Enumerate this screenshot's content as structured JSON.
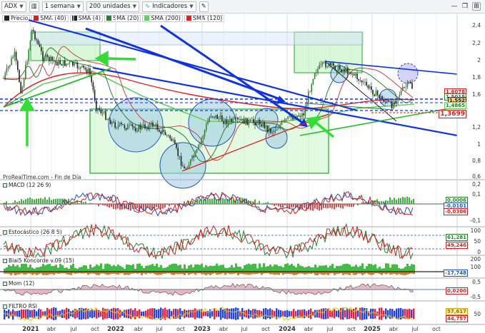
{
  "toolbar": {
    "symbol": "ADX",
    "interval": "1 semana",
    "units": "200 unidades",
    "indicators_label": "Indicadores"
  },
  "legend": [
    {
      "label": "Precio",
      "color": "#222222"
    },
    {
      "label": "SMA (40)",
      "color": "#cc2222"
    },
    {
      "label": "SMA (4)",
      "color": "#222222"
    },
    {
      "label": "SMA (20)",
      "color": "#2e7d32"
    },
    {
      "label": "SMA (200)",
      "color": "#66cc66"
    },
    {
      "label": "SMA (120)",
      "color": "#dd2222"
    }
  ],
  "main_chart": {
    "source_text": "ProRealTime.com - Fin de Día",
    "y_ticks": [
      "2,4",
      "2,2",
      "2",
      "1,8",
      "1,6",
      "1,4",
      "1,2",
      "1",
      "0,8",
      "0,6"
    ],
    "value_boxes": [
      {
        "text": "1,6078",
        "color": "#cc2222"
      },
      {
        "text": "1,5015",
        "color": "#2e7d32"
      },
      {
        "text": "1,552",
        "color": "#222222"
      },
      {
        "text": "1,4865",
        "color": "#66cc66"
      },
      {
        "text": "1,3699",
        "color": "#cc2222"
      }
    ]
  },
  "panels": [
    {
      "name": "MACD (12 26 9)",
      "ticks": [
        "0,2",
        "0,1",
        "0",
        "-0,1"
      ],
      "values": [
        "0,0006",
        "-0,0101",
        "-0,0306"
      ]
    },
    {
      "name": "Estocástico (26 8 5)",
      "ticks": [
        "100",
        "50",
        "0"
      ],
      "values": [
        "61,281",
        "49,246"
      ]
    },
    {
      "name": "Blai5 Koncorde v.09 (15)",
      "ticks": [
        "200",
        "100",
        "0"
      ],
      "values": [
        "-17,748"
      ]
    },
    {
      "name": "Mom (12)",
      "ticks": [
        "0,5",
        "0",
        "-0,5"
      ],
      "values": [
        "0,0200"
      ]
    },
    {
      "name": "FILTRO RSI",
      "ticks": [
        "50"
      ],
      "values": [
        "57,617",
        "44,757"
      ]
    }
  ],
  "x_axis": [
    "2021",
    "abr",
    "jul",
    "oct",
    "2022",
    "abr",
    "jul",
    "oct",
    "2023",
    "abr",
    "jul",
    "oct",
    "2024",
    "abr",
    "jul",
    "oct",
    "2025",
    "abr",
    "jul",
    "oct"
  ],
  "icons": {
    "toolbar_chart": "candlestick-icon",
    "indicators": "indicators-icon",
    "minimize": "minimize-icon",
    "maximize": "maximize-icon",
    "close": "close-icon"
  }
}
